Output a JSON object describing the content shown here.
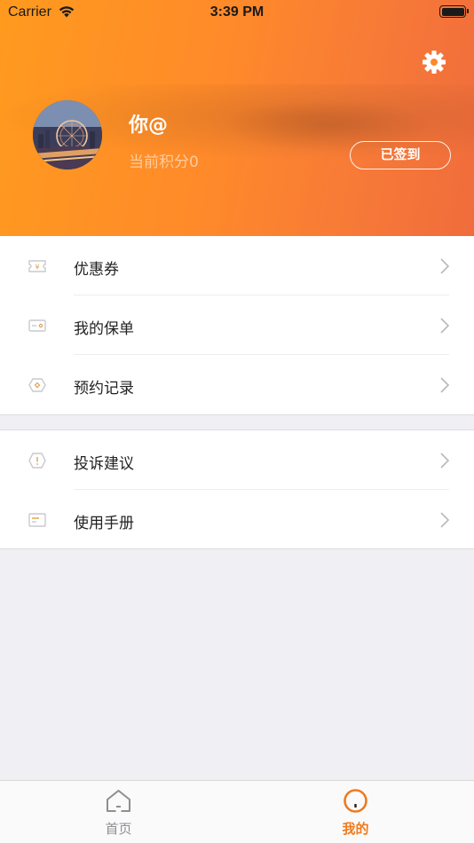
{
  "status_bar": {
    "carrier": "Carrier",
    "time": "3:39 PM"
  },
  "profile": {
    "username": "你@",
    "points_text": "当前积分0",
    "checkin_label": "已签到",
    "settings_icon": "gear-icon"
  },
  "menu_group1": [
    {
      "label": "优惠券",
      "icon": "coupon-icon"
    },
    {
      "label": "我的保单",
      "icon": "card-icon"
    },
    {
      "label": "预约记录",
      "icon": "appointment-icon"
    }
  ],
  "menu_group2": [
    {
      "label": "投诉建议",
      "icon": "complaint-icon"
    },
    {
      "label": "使用手册",
      "icon": "manual-icon"
    }
  ],
  "tabbar": {
    "tabs": [
      {
        "label": "首页",
        "icon": "home-icon",
        "active": false
      },
      {
        "label": "我的",
        "icon": "profile-icon",
        "active": true
      }
    ]
  },
  "colors": {
    "accent": "#f07a1d",
    "header_start": "#ff9a1e",
    "header_end": "#f06c3c"
  }
}
